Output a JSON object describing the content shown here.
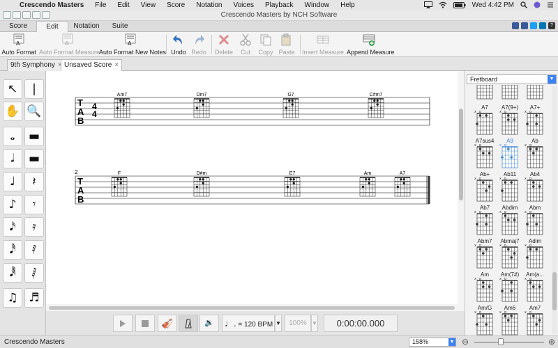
{
  "menubar": {
    "app_name": "Crescendo Masters",
    "items": [
      "File",
      "Edit",
      "View",
      "Score",
      "Notation",
      "Voices",
      "Playback",
      "Window",
      "Help"
    ],
    "clock": "Wed 4:42 PM"
  },
  "window": {
    "title": "Crescendo Masters by NCH Software"
  },
  "tabs": [
    "Score",
    "Edit",
    "Notation",
    "Suite"
  ],
  "ribbon": {
    "buttons": [
      {
        "label": "Auto Format",
        "enabled": true,
        "icon": "auto-format-icon"
      },
      {
        "label": "Auto Format Measure",
        "enabled": false,
        "icon": "auto-format-measure-icon"
      },
      {
        "label": "Auto Format New Notes",
        "enabled": true,
        "icon": "auto-format-new-notes-icon"
      },
      {
        "label": "Undo",
        "enabled": true,
        "icon": "undo-icon"
      },
      {
        "label": "Redo",
        "enabled": false,
        "icon": "redo-icon"
      },
      {
        "label": "Delete",
        "enabled": false,
        "icon": "delete-icon"
      },
      {
        "label": "Cut",
        "enabled": false,
        "icon": "cut-icon"
      },
      {
        "label": "Copy",
        "enabled": false,
        "icon": "copy-icon"
      },
      {
        "label": "Paste",
        "enabled": false,
        "icon": "paste-icon"
      },
      {
        "label": "Insert Measure",
        "enabled": false,
        "icon": "insert-measure-icon"
      },
      {
        "label": "Append Measure",
        "enabled": true,
        "icon": "append-measure-icon"
      }
    ]
  },
  "doc_tabs": [
    {
      "label": "9th Symphony",
      "active": false
    },
    {
      "label": "Unsaved Score",
      "active": true
    }
  ],
  "score": {
    "systems": [
      {
        "measure_number": "",
        "chords": [
          "Am7",
          "Dm7",
          "G7",
          "C#m7"
        ]
      },
      {
        "measure_number": "2",
        "chords": [
          "F",
          "D#m",
          "E7",
          "Am",
          "A7"
        ]
      }
    ],
    "tab_label": [
      "T",
      "A",
      "B"
    ],
    "time_signature": [
      "4",
      "4"
    ]
  },
  "transport": {
    "tempo": "= 120 BPM",
    "volume": "100%",
    "time": "0:00:00.000"
  },
  "fretboard": {
    "selector": "Fretboard",
    "chords": [
      "A7",
      "A7(9+)",
      "A7+",
      "A7sus4",
      "A9",
      "Ab",
      "Ab+",
      "Ab11",
      "Ab4",
      "Ab7",
      "Abdim",
      "Abm",
      "Abm7",
      "Abmaj7",
      "Adim",
      "Am",
      "Am(7#)",
      "Am(a...",
      "Am/G",
      "Am6",
      "Am7"
    ],
    "selected": "A9"
  },
  "status": {
    "text": "Crescendo Masters",
    "zoom": "158%"
  },
  "colors": {
    "accent": "#3b82f6",
    "staff_line": "#555555",
    "chord_selected": "#3a86d6"
  }
}
